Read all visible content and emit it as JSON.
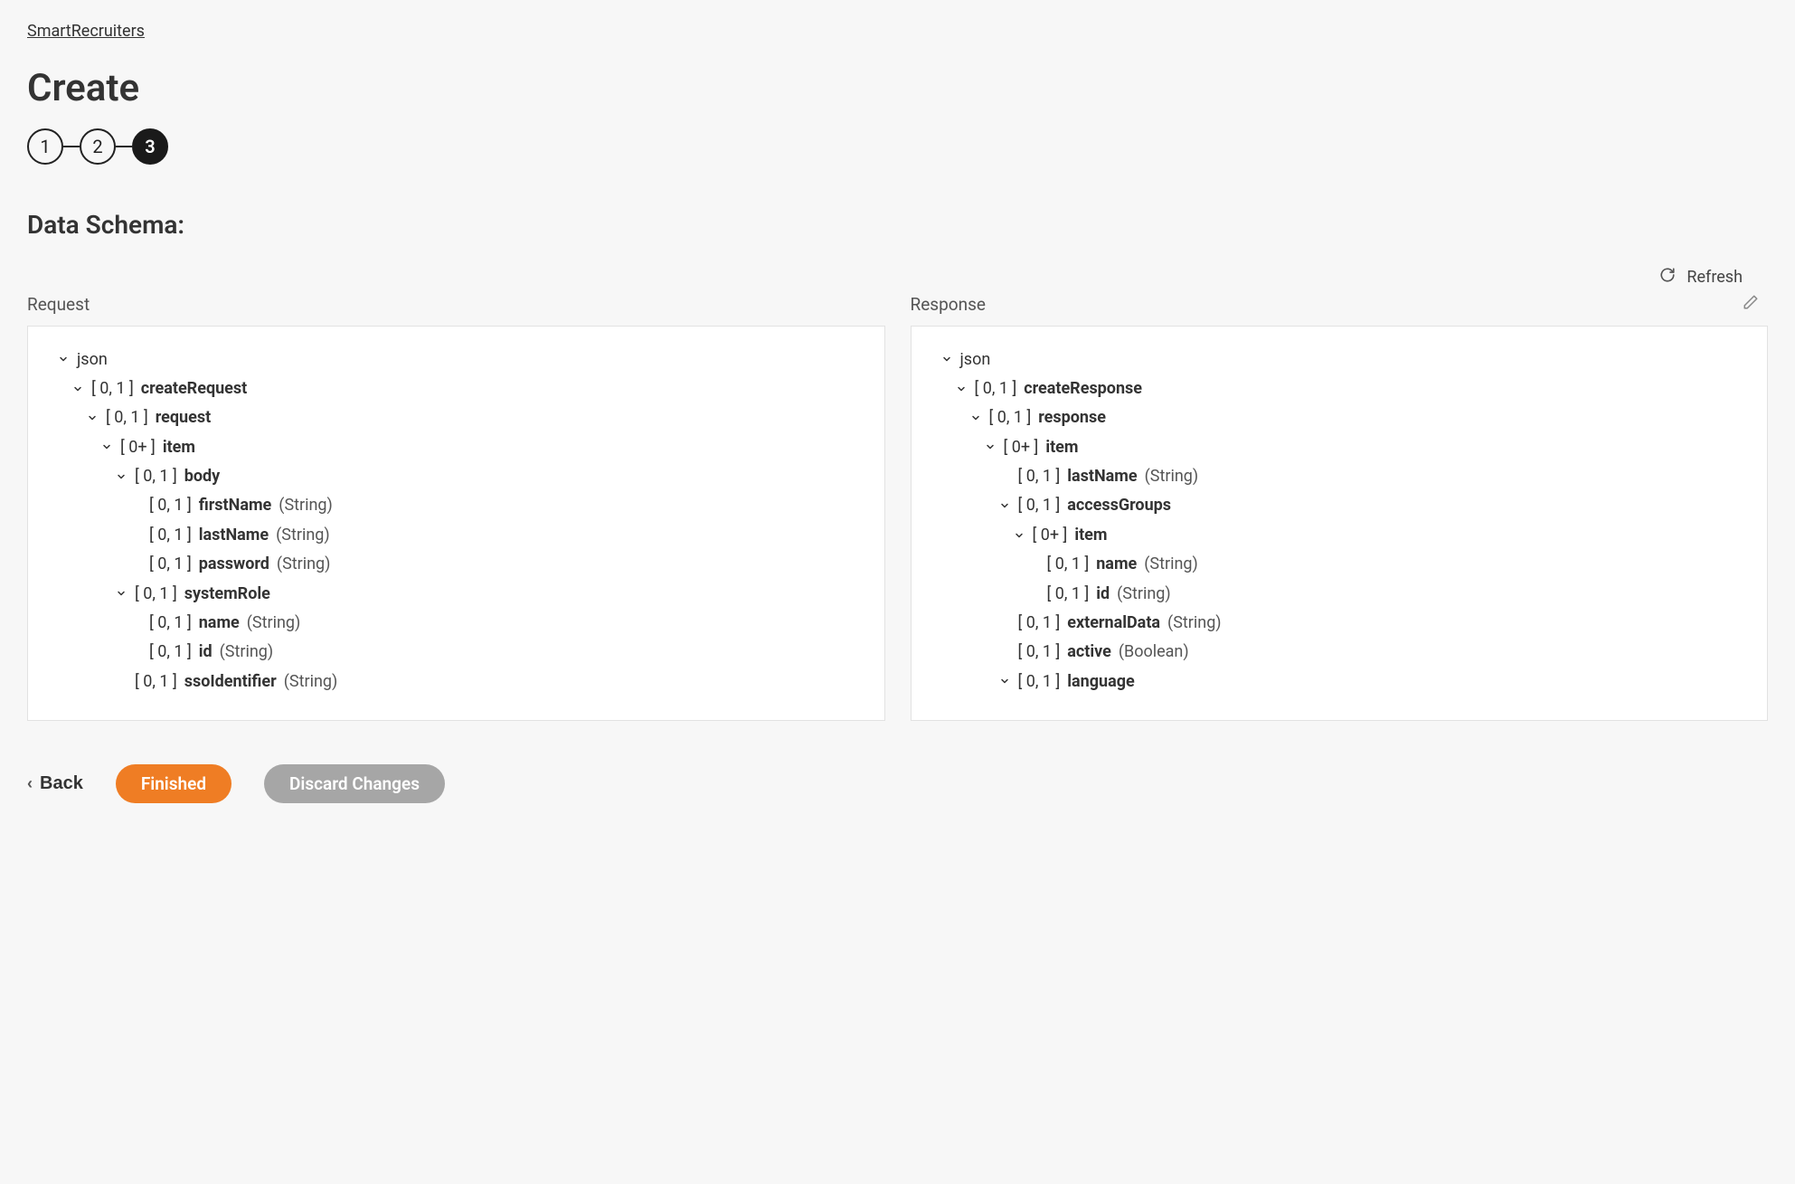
{
  "breadcrumb": "SmartRecruiters",
  "title": "Create",
  "steps": [
    "1",
    "2",
    "3"
  ],
  "activeStep": 2,
  "sectionTitle": "Data Schema:",
  "refreshLabel": "Refresh",
  "panels": {
    "request": {
      "label": "Request",
      "tree": [
        {
          "indent": 0,
          "arrow": true,
          "card": "",
          "name": "json",
          "type": ""
        },
        {
          "indent": 1,
          "arrow": true,
          "card": "[ 0, 1 ]",
          "name": "createRequest",
          "type": ""
        },
        {
          "indent": 2,
          "arrow": true,
          "card": "[ 0, 1 ]",
          "name": "request",
          "type": ""
        },
        {
          "indent": 3,
          "arrow": true,
          "card": "[ 0+ ]",
          "name": "item",
          "type": ""
        },
        {
          "indent": 4,
          "arrow": true,
          "card": "[ 0, 1 ]",
          "name": "body",
          "type": ""
        },
        {
          "indent": 5,
          "arrow": false,
          "card": "[ 0, 1 ]",
          "name": "firstName",
          "type": "(String)"
        },
        {
          "indent": 5,
          "arrow": false,
          "card": "[ 0, 1 ]",
          "name": "lastName",
          "type": "(String)"
        },
        {
          "indent": 5,
          "arrow": false,
          "card": "[ 0, 1 ]",
          "name": "password",
          "type": "(String)"
        },
        {
          "indent": 4,
          "arrow": true,
          "card": "[ 0, 1 ]",
          "name": "systemRole",
          "type": ""
        },
        {
          "indent": 5,
          "arrow": false,
          "card": "[ 0, 1 ]",
          "name": "name",
          "type": "(String)"
        },
        {
          "indent": 5,
          "arrow": false,
          "card": "[ 0, 1 ]",
          "name": "id",
          "type": "(String)"
        },
        {
          "indent": 4,
          "arrow": false,
          "card": "[ 0, 1 ]",
          "name": "ssoIdentifier",
          "type": "(String)"
        }
      ]
    },
    "response": {
      "label": "Response",
      "tree": [
        {
          "indent": 0,
          "arrow": true,
          "card": "",
          "name": "json",
          "type": ""
        },
        {
          "indent": 1,
          "arrow": true,
          "card": "[ 0, 1 ]",
          "name": "createResponse",
          "type": ""
        },
        {
          "indent": 2,
          "arrow": true,
          "card": "[ 0, 1 ]",
          "name": "response",
          "type": ""
        },
        {
          "indent": 3,
          "arrow": true,
          "card": "[ 0+ ]",
          "name": "item",
          "type": ""
        },
        {
          "indent": 4,
          "arrow": false,
          "card": "[ 0, 1 ]",
          "name": "lastName",
          "type": "(String)"
        },
        {
          "indent": 4,
          "arrow": true,
          "card": "[ 0, 1 ]",
          "name": "accessGroups",
          "type": ""
        },
        {
          "indent": 5,
          "arrow": true,
          "card": "[ 0+ ]",
          "name": "item",
          "type": ""
        },
        {
          "indent": 6,
          "arrow": false,
          "card": "[ 0, 1 ]",
          "name": "name",
          "type": "(String)"
        },
        {
          "indent": 6,
          "arrow": false,
          "card": "[ 0, 1 ]",
          "name": "id",
          "type": "(String)"
        },
        {
          "indent": 4,
          "arrow": false,
          "card": "[ 0, 1 ]",
          "name": "externalData",
          "type": "(String)"
        },
        {
          "indent": 4,
          "arrow": false,
          "card": "[ 0, 1 ]",
          "name": "active",
          "type": "(Boolean)"
        },
        {
          "indent": 4,
          "arrow": true,
          "card": "[ 0, 1 ]",
          "name": "language",
          "type": ""
        }
      ]
    }
  },
  "footer": {
    "back": "Back",
    "finished": "Finished",
    "discard": "Discard Changes"
  }
}
